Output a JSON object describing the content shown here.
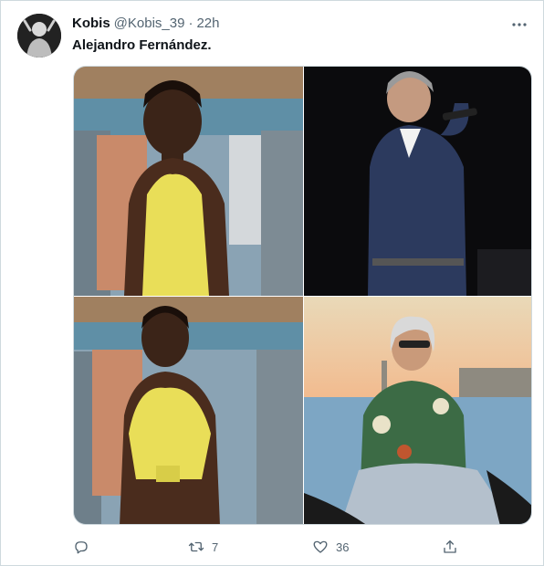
{
  "tweet": {
    "display_name": "Kobis",
    "handle": "@Kobis_39",
    "separator": "·",
    "time": "22h",
    "text": "Alejandro Fernández."
  },
  "icons": {
    "more": "more-horizontal-icon",
    "reply": "reply-icon",
    "retweet": "retweet-icon",
    "like": "heart-icon",
    "share": "share-icon"
  },
  "actions": {
    "retweets": "7",
    "likes": "36"
  },
  "colors": {
    "text": "#0f1419",
    "secondary": "#536471",
    "border": "#cfd9de"
  }
}
